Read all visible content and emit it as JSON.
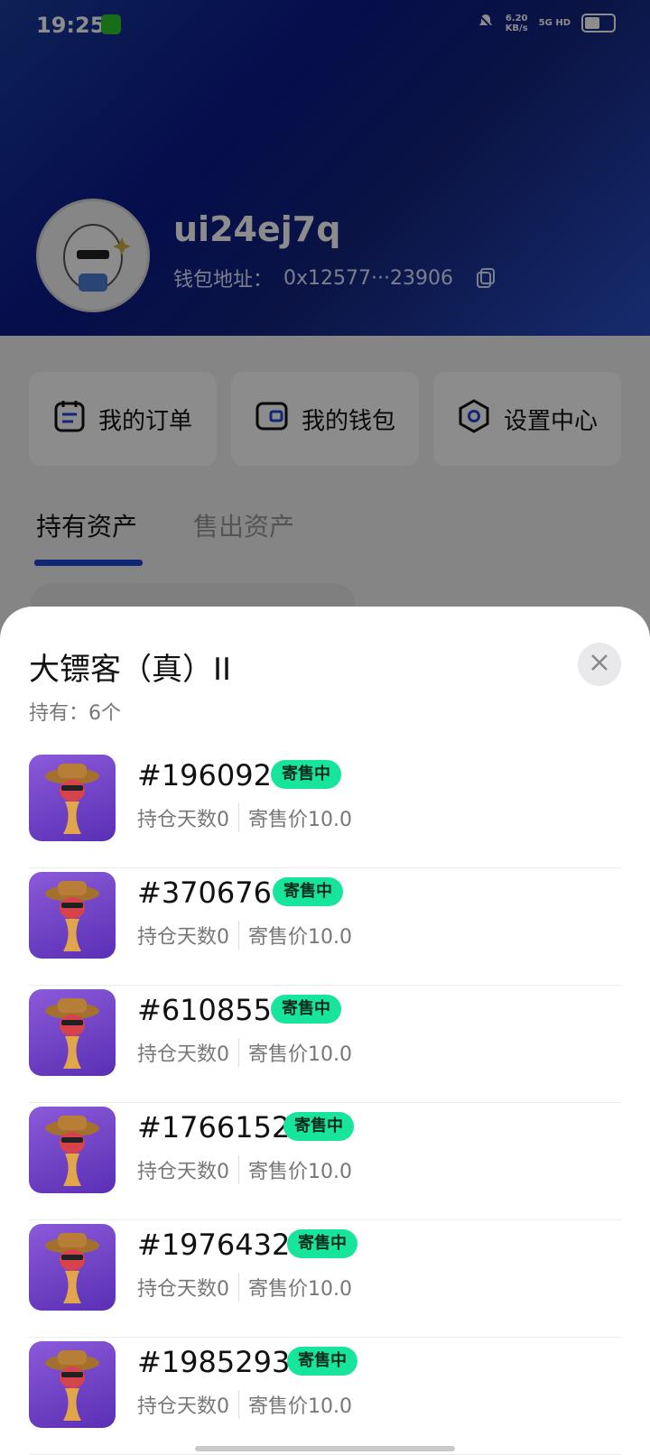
{
  "status_bar": {
    "time": "19:25",
    "net_speed": "6.20",
    "net_unit": "KB/s",
    "net_type": "5G HD"
  },
  "profile": {
    "username": "ui24ej7q",
    "wallet_label": "钱包地址：",
    "wallet_address": "0x12577···23906"
  },
  "quick_actions": [
    {
      "label": "我的订单",
      "icon": "order-icon"
    },
    {
      "label": "我的钱包",
      "icon": "wallet-icon"
    },
    {
      "label": "设置中心",
      "icon": "settings-icon"
    }
  ],
  "tabs": {
    "active": "持有资产",
    "inactive": "售出资产"
  },
  "sheet": {
    "title": "大镖客（真）II",
    "hold_count": "持有：6个",
    "items": [
      {
        "id": "#196092",
        "status": "寄售中",
        "days": "持仓天数0",
        "price": "寄售价10.0"
      },
      {
        "id": "#370676",
        "status": "寄售中",
        "days": "持仓天数0",
        "price": "寄售价10.0"
      },
      {
        "id": "#610855",
        "status": "寄售中",
        "days": "持仓天数0",
        "price": "寄售价10.0"
      },
      {
        "id": "#1766152",
        "status": "寄售中",
        "days": "持仓天数0",
        "price": "寄售价10.0"
      },
      {
        "id": "#1976432",
        "status": "寄售中",
        "days": "持仓天数0",
        "price": "寄售价10.0"
      },
      {
        "id": "#1985293",
        "status": "寄售中",
        "days": "持仓天数0",
        "price": "寄售价10.0"
      }
    ]
  },
  "colors": {
    "accent": "#1d47d4",
    "badge": "#17e59c"
  }
}
